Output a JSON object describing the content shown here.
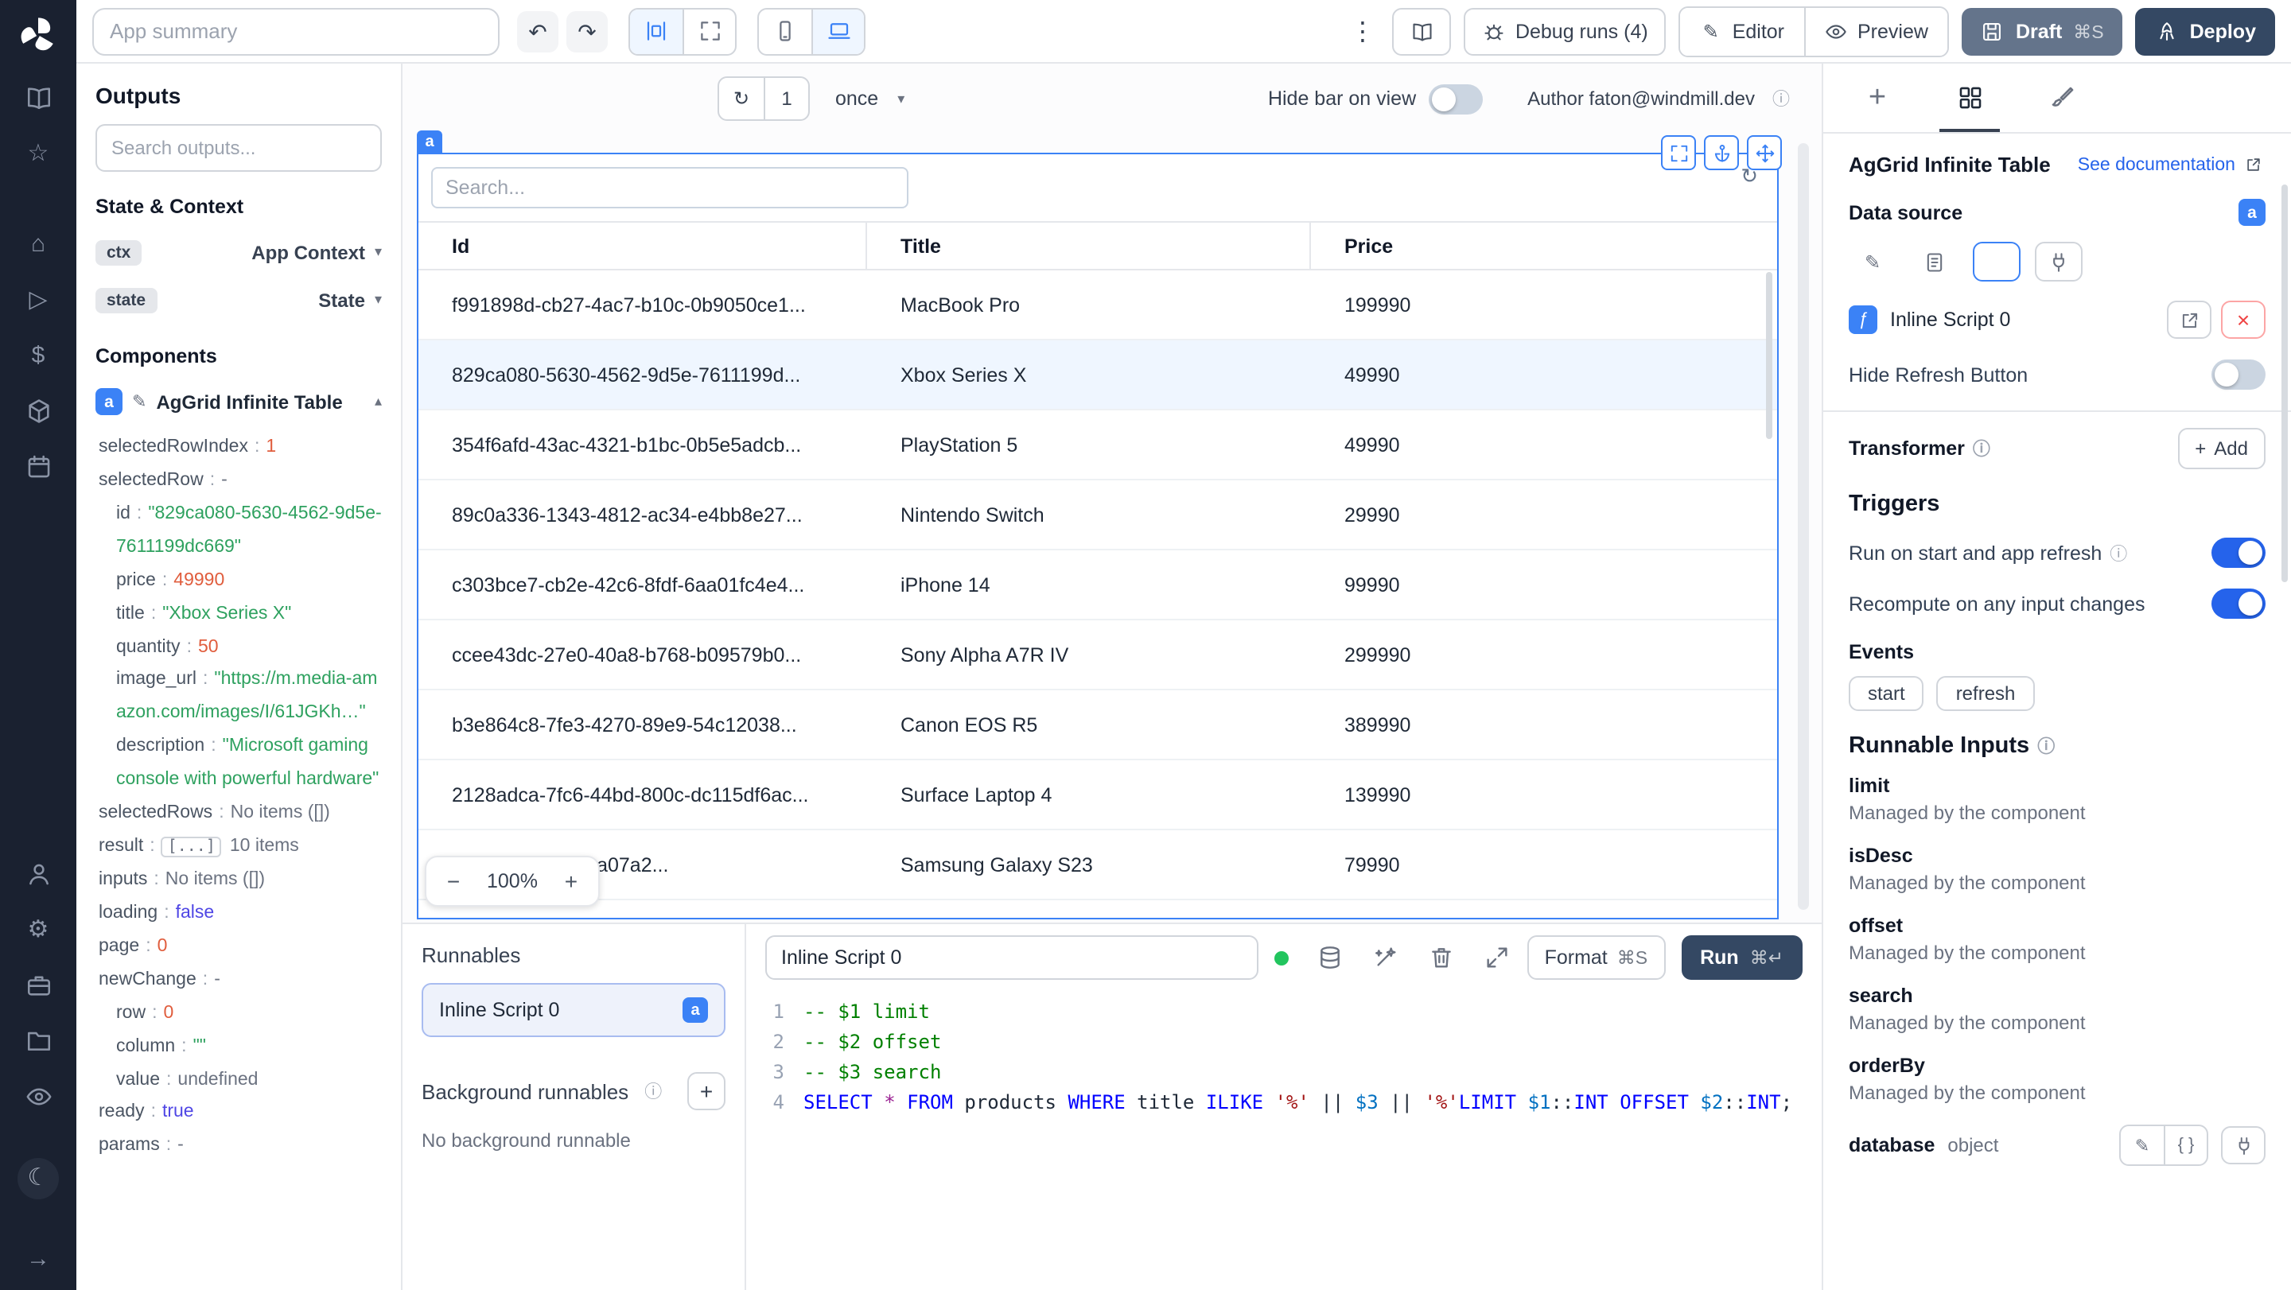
{
  "colors": {
    "accent": "#3b82f6",
    "rail_bg": "#1a2130",
    "draft_button": "#64748b",
    "deploy_button": "#344863",
    "selected_row_bg": "#eff6ff",
    "toggle_on": "#2563eb",
    "run_dot": "#22c55e"
  },
  "rail": {
    "icons": [
      "book",
      "star",
      "home",
      "play",
      "dollar",
      "cube",
      "calendar",
      "user",
      "gear",
      "briefcase",
      "folder",
      "eye",
      "moon",
      "arrow-right"
    ]
  },
  "header": {
    "app_summary_placeholder": "App summary",
    "debug_runs_label": "Debug runs (4)",
    "editor_label": "Editor",
    "preview_label": "Preview",
    "draft_label": "Draft",
    "draft_shortcut": "⌘S",
    "deploy_label": "Deploy"
  },
  "outputs": {
    "title": "Outputs",
    "search_placeholder": "Search outputs...",
    "state_context_title": "State & Context",
    "components_title": "Components",
    "context_rows": [
      {
        "badge": "ctx",
        "label": "App Context"
      },
      {
        "badge": "state",
        "label": "State"
      }
    ],
    "component": {
      "badge": "a",
      "name": "AgGrid Infinite Table"
    },
    "tree": [
      {
        "key": "selectedRowIndex",
        "value": "1",
        "type": "num",
        "indent": 0
      },
      {
        "key": "selectedRow",
        "value": "-",
        "type": "muted",
        "indent": 0
      },
      {
        "key": "id",
        "value": "\"829ca080-5630-4562-9d5e-7611199dc669\"",
        "type": "str",
        "indent": 1
      },
      {
        "key": "price",
        "value": "49990",
        "type": "num",
        "indent": 1
      },
      {
        "key": "title",
        "value": "\"Xbox Series X\"",
        "type": "str",
        "indent": 1
      },
      {
        "key": "quantity",
        "value": "50",
        "type": "num",
        "indent": 1
      },
      {
        "key": "image_url",
        "value": "\"https://m.media-amazon.com/images/I/61JGKh…\"",
        "type": "str",
        "indent": 1
      },
      {
        "key": "description",
        "value": "\"Microsoft gaming console with powerful hardware\"",
        "type": "str",
        "indent": 1
      },
      {
        "key": "selectedRows",
        "value": "No items ([])",
        "type": "plain",
        "indent": 0
      },
      {
        "key": "result",
        "value": "[...]",
        "suffix": "10 items",
        "type": "box",
        "indent": 0
      },
      {
        "key": "inputs",
        "value": "No items ([])",
        "type": "plain",
        "indent": 0
      },
      {
        "key": "loading",
        "value": "false",
        "type": "bool",
        "indent": 0
      },
      {
        "key": "page",
        "value": "0",
        "type": "num",
        "indent": 0
      },
      {
        "key": "newChange",
        "value": "-",
        "type": "muted",
        "indent": 0
      },
      {
        "key": "row",
        "value": "0",
        "type": "num",
        "indent": 1
      },
      {
        "key": "column",
        "value": "\"\"",
        "type": "str",
        "indent": 1
      },
      {
        "key": "value",
        "value": "undefined",
        "type": "plain",
        "indent": 1
      },
      {
        "key": "ready",
        "value": "true",
        "type": "bool",
        "indent": 0
      },
      {
        "key": "params",
        "value": "-",
        "type": "muted",
        "indent": 0
      }
    ]
  },
  "canvas": {
    "refresh_count": "1",
    "frequency": "once",
    "hide_bar_label": "Hide bar on view",
    "author_label": "Author faton@windmill.dev",
    "zoom": {
      "minus": "−",
      "level": "100%",
      "plus": "+"
    },
    "grid": {
      "tag": "a",
      "search_placeholder": "Search...",
      "columns": [
        "Id",
        "Title",
        "Price"
      ],
      "rows": [
        {
          "id": "f991898d-cb27-4ac7-b10c-0b9050ce1...",
          "title": "MacBook Pro",
          "price": "199990",
          "selected": false
        },
        {
          "id": "829ca080-5630-4562-9d5e-7611199d...",
          "title": "Xbox Series X",
          "price": "49990",
          "selected": true
        },
        {
          "id": "354f6afd-43ac-4321-b1bc-0b5e5adcb...",
          "title": "PlayStation 5",
          "price": "49990",
          "selected": false
        },
        {
          "id": "89c0a336-1343-4812-ac34-e4bb8e27...",
          "title": "Nintendo Switch",
          "price": "29990",
          "selected": false
        },
        {
          "id": "c303bce7-cb2e-42c6-8fdf-6aa01fc4e4...",
          "title": "iPhone 14",
          "price": "99990",
          "selected": false
        },
        {
          "id": "ccee43dc-27e0-40a8-b768-b09579b0...",
          "title": "Sony Alpha A7R IV",
          "price": "299990",
          "selected": false
        },
        {
          "id": "b3e864c8-7fe3-4270-89e9-54c12038...",
          "title": "Canon EOS R5",
          "price": "389990",
          "selected": false
        },
        {
          "id": "2128adca-7fc6-44bd-800c-dc115df6ac...",
          "title": "Surface Laptop 4",
          "price": "139990",
          "selected": false
        },
        {
          "id": "4c83-8022-5e70a07a2...",
          "title": "Samsung Galaxy S23",
          "price": "79990",
          "selected": false
        }
      ]
    }
  },
  "runnables": {
    "title": "Runnables",
    "item": {
      "label": "Inline Script 0",
      "badge": "a"
    },
    "background_title": "Background runnables",
    "background_empty": "No background runnable"
  },
  "editor": {
    "name_value": "Inline Script 0",
    "format_label": "Format",
    "format_shortcut": "⌘S",
    "run_label": "Run",
    "run_shortcut": "⌘↵",
    "lines": [
      {
        "no": "1",
        "tokens": [
          {
            "t": "-- $1 limit",
            "c": "com"
          }
        ]
      },
      {
        "no": "2",
        "tokens": [
          {
            "t": "-- $2 offset",
            "c": "com"
          }
        ]
      },
      {
        "no": "3",
        "tokens": [
          {
            "t": "-- $3 search",
            "c": "com"
          }
        ]
      },
      {
        "no": "4",
        "tokens": [
          {
            "t": "SELECT",
            "c": "kw"
          },
          {
            "t": " ",
            "c": "p"
          },
          {
            "t": "*",
            "c": "op"
          },
          {
            "t": " ",
            "c": "p"
          },
          {
            "t": "FROM",
            "c": "kw"
          },
          {
            "t": " products ",
            "c": "p"
          },
          {
            "t": "WHERE",
            "c": "kw"
          },
          {
            "t": " title ",
            "c": "p"
          },
          {
            "t": "ILIKE",
            "c": "kw"
          },
          {
            "t": " ",
            "c": "p"
          },
          {
            "t": "'%'",
            "c": "str"
          },
          {
            "t": " || ",
            "c": "p"
          },
          {
            "t": "$3",
            "c": "var"
          },
          {
            "t": " || ",
            "c": "p"
          },
          {
            "t": "'%'",
            "c": "str"
          },
          {
            "t": "LIMIT",
            "c": "kw"
          },
          {
            "t": " ",
            "c": "p"
          },
          {
            "t": "$1",
            "c": "var"
          },
          {
            "t": "::",
            "c": "p"
          },
          {
            "t": "INT",
            "c": "kw"
          },
          {
            "t": " ",
            "c": "p"
          },
          {
            "t": "OFFSET",
            "c": "kw"
          },
          {
            "t": " ",
            "c": "p"
          },
          {
            "t": "$2",
            "c": "var"
          },
          {
            "t": "::",
            "c": "p"
          },
          {
            "t": "INT",
            "c": "kw"
          },
          {
            "t": ";",
            "c": "p"
          }
        ]
      }
    ]
  },
  "inspector": {
    "component_title": "AgGrid Infinite Table",
    "doc_link": "See documentation",
    "data_source_label": "Data source",
    "data_source_badge": "a",
    "script_name": "Inline Script 0",
    "hide_refresh_label": "Hide Refresh Button",
    "transformer_label": "Transformer",
    "add_label": "Add",
    "triggers_title": "Triggers",
    "trigger_rows": [
      {
        "label": "Run on start and app refresh",
        "info": true,
        "on": true
      },
      {
        "label": "Recompute on any input changes",
        "info": false,
        "on": true
      }
    ],
    "events_label": "Events",
    "event_chips": [
      "start",
      "refresh"
    ],
    "runnable_inputs_title": "Runnable Inputs",
    "fields": [
      {
        "name": "limit",
        "desc": "Managed by the component"
      },
      {
        "name": "isDesc",
        "desc": "Managed by the component"
      },
      {
        "name": "offset",
        "desc": "Managed by the component"
      },
      {
        "name": "search",
        "desc": "Managed by the component"
      },
      {
        "name": "orderBy",
        "desc": "Managed by the component"
      },
      {
        "name": "database",
        "type": "object"
      }
    ]
  }
}
